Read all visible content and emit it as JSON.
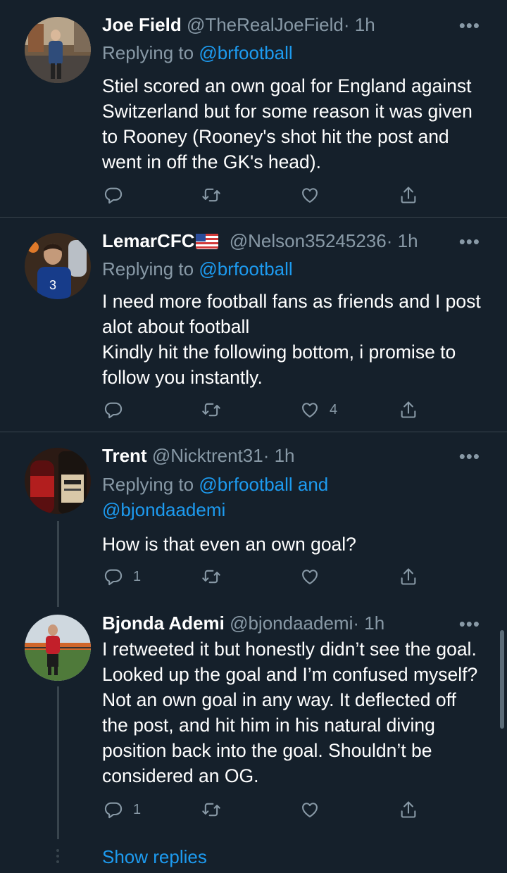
{
  "tweets": [
    {
      "name": "Joe Field",
      "handle": "@TheRealJoeField",
      "time": "· 1h",
      "replying_prefix": "Replying to ",
      "replying_to": "@brfootball",
      "text": "Stiel scored an own goal for England against Switzerland but for some reason it was given to Rooney (Rooney's shot hit the post and went in off the GK's head).",
      "reply_count": "",
      "like_count": ""
    },
    {
      "name": "LemarCFC",
      "handle": "@Nelson35245236",
      "time": "· 1h",
      "replying_prefix": "Replying to ",
      "replying_to": "@brfootball",
      "text_lines": [
        "I need more football fans as friends and I post alot about football",
        "Kindly hit the following bottom, i promise to follow you instantly."
      ],
      "reply_count": "",
      "like_count": "4"
    },
    {
      "name": "Trent",
      "handle": "@Nicktrent31",
      "time": "· 1h",
      "replying_prefix": "Replying to ",
      "replying_to": "@brfootball and @bjondaademi",
      "text": "How is that even an own goal?",
      "reply_count": "1",
      "like_count": ""
    },
    {
      "name": "Bjonda Ademi",
      "handle": "@bjondaademi",
      "time": "· 1h",
      "text": "I retweeted it but honestly didn’t see the goal. Looked up the goal and I’m confused myself? Not an own goal in any way. It deflected off the post, and hit him in his natural diving position back into the goal. Shouldn’t be considered an OG.",
      "reply_count": "1",
      "like_count": ""
    }
  ],
  "show_replies_label": "Show replies",
  "more_label": "•••",
  "icons": [
    "reply-icon",
    "retweet-icon",
    "like-icon",
    "share-icon",
    "more-icon"
  ],
  "colors": {
    "background": "#15202b",
    "accent": "#1d9bf0",
    "muted": "#8899a6",
    "divider": "#38444d"
  }
}
